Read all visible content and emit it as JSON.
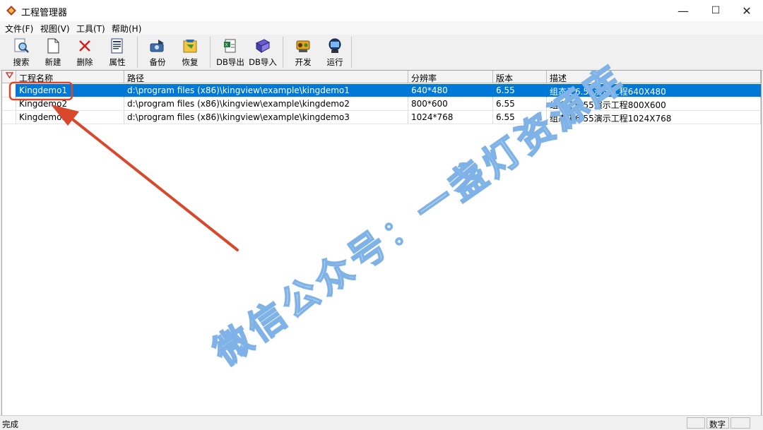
{
  "window": {
    "title": "工程管理器"
  },
  "window_controls": {
    "minimize": "—",
    "maximize": "☐",
    "close": "✕"
  },
  "menu": [
    {
      "label": "文件(F)"
    },
    {
      "label": "视图(V)"
    },
    {
      "label": "工具(T)"
    },
    {
      "label": "帮助(H)"
    }
  ],
  "toolbar": [
    {
      "label": "搜索",
      "icon": "search-icon"
    },
    {
      "label": "新建",
      "icon": "new-file-icon"
    },
    {
      "label": "删除",
      "icon": "delete-icon"
    },
    {
      "label": "属性",
      "icon": "properties-icon"
    },
    {
      "label": "备份",
      "icon": "backup-icon"
    },
    {
      "label": "恢复",
      "icon": "restore-icon"
    },
    {
      "label": "DB导出",
      "icon": "db-export-icon"
    },
    {
      "label": "DB导入",
      "icon": "db-import-icon"
    },
    {
      "label": "开发",
      "icon": "develop-icon"
    },
    {
      "label": "运行",
      "icon": "run-icon"
    }
  ],
  "table": {
    "columns": [
      "工程名称",
      "路径",
      "分辨率",
      "版本",
      "描述"
    ],
    "rows": [
      {
        "name": "Kingdemo1",
        "path": "d:\\program files (x86)\\kingview\\example\\kingdemo1",
        "resolution": "640*480",
        "version": "6.55",
        "description": "组态王6.55演示工程640X480",
        "selected": true
      },
      {
        "name": "Kingdemo2",
        "path": "d:\\program files (x86)\\kingview\\example\\kingdemo2",
        "resolution": "800*600",
        "version": "6.55",
        "description": "组态王6.55演示工程800X600",
        "selected": false
      },
      {
        "name": "Kingdemo3",
        "path": "d:\\program files (x86)\\kingview\\example\\kingdemo3",
        "resolution": "1024*768",
        "version": "6.55",
        "description": "组态王6.55演示工程1024X768",
        "selected": false
      }
    ]
  },
  "status": {
    "text": "完成",
    "pane_num": "数字"
  },
  "watermark": {
    "text": "微信公众号：一盏灯资源库"
  },
  "colors": {
    "selection": "#0078d7",
    "annotation": "#d9482b",
    "watermark_stroke": "#7fb2e6"
  }
}
